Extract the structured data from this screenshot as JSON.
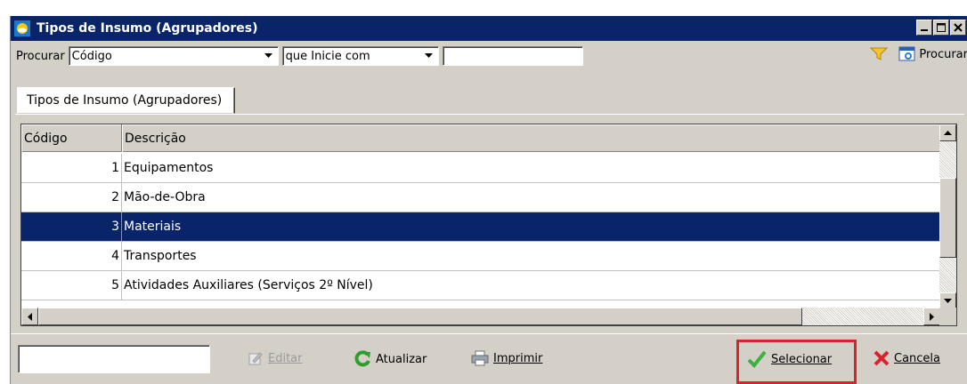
{
  "window": {
    "title": "Tipos de Insumo (Agrupadores)",
    "controls": [
      "minimize",
      "maximize",
      "close"
    ]
  },
  "search": {
    "label": "Procurar",
    "field_value": "Código",
    "match_value": "que Inicie com",
    "text_value": "",
    "button_label": "Procurar"
  },
  "tabs": [
    {
      "label": "Tipos de Insumo (Agrupadores)",
      "active": true
    }
  ],
  "grid": {
    "columns": [
      "Código",
      "Descrição"
    ],
    "rows": [
      {
        "code": "1",
        "description": "Equipamentos",
        "selected": false
      },
      {
        "code": "2",
        "description": "Mão-de-Obra",
        "selected": false
      },
      {
        "code": "3",
        "description": "Materiais",
        "selected": true
      },
      {
        "code": "4",
        "description": "Transportes",
        "selected": false
      },
      {
        "code": "5",
        "description": "Atividades Auxiliares (Serviços 2º Nível)",
        "selected": false
      }
    ]
  },
  "footer": {
    "quick_input_value": "",
    "edit_label": "Editar",
    "refresh_label": "Atualizar",
    "print_label": "Imprimir",
    "select_label": "Selecionar",
    "cancel_label": "Cancela"
  },
  "colors": {
    "title_bar": "#0a246a",
    "selection": "#0a246a",
    "face": "#d4d0c8",
    "highlight_box": "#d9232a"
  }
}
